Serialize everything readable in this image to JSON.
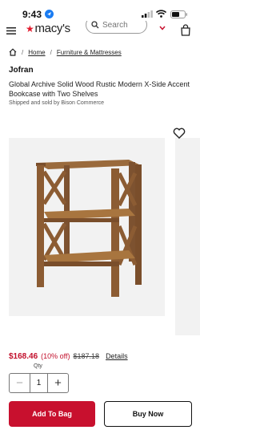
{
  "status_bar": {
    "time": "9:43"
  },
  "header": {
    "logo_text": "macy's",
    "search_placeholder": "Search"
  },
  "breadcrumb": {
    "items": [
      "Home",
      "Furniture & Mattresses"
    ]
  },
  "product": {
    "brand": "Jofran",
    "title": "Global Archive Solid Wood Rustic Modern X-Side Accent Bookcase with Two Shelves",
    "seller": "Shipped and sold by Bison Commerce"
  },
  "pricing": {
    "sale_price": "$168.46",
    "discount": "(10% off)",
    "original_price": "$187.18",
    "details_label": "Details"
  },
  "quantity": {
    "label": "Qty",
    "value": "1",
    "minus": "−",
    "plus": "+"
  },
  "actions": {
    "add_to_bag": "Add To Bag",
    "buy_now": "Buy Now"
  },
  "colors": {
    "brand_red": "#c8102e",
    "sale_red": "#c2102c"
  },
  "icons": [
    "location-arrow-icon",
    "signal-icon",
    "wifi-icon",
    "battery-icon",
    "menu-icon",
    "search-icon",
    "chevron-down-icon",
    "bag-icon",
    "home-icon",
    "heart-icon"
  ]
}
